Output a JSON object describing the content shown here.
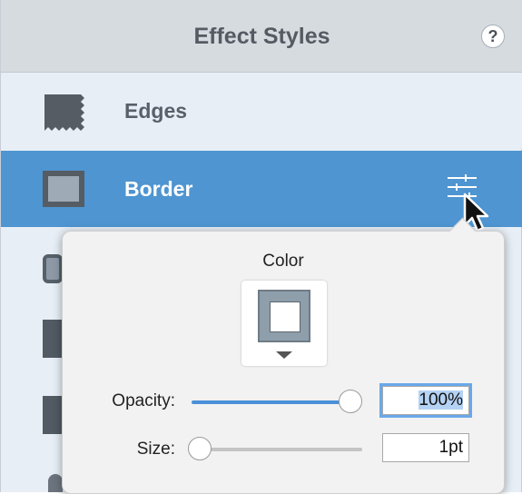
{
  "header": {
    "title": "Effect Styles",
    "help_label": "?"
  },
  "styles": [
    {
      "label": "Edges",
      "icon": "edges-icon",
      "selected": false
    },
    {
      "label": "Border",
      "icon": "border-icon",
      "selected": true
    }
  ],
  "popover": {
    "color_label": "Color",
    "swatch_color": "#8e9eaa",
    "opacity_label": "Opacity:",
    "opacity_value": "100%",
    "opacity_fraction": 1.0,
    "size_label": "Size:",
    "size_value": "1pt",
    "size_fraction": 0.0
  },
  "colors": {
    "accent": "#4e95d1",
    "panel": "#e7eef6",
    "header": "#d6dbe0"
  }
}
